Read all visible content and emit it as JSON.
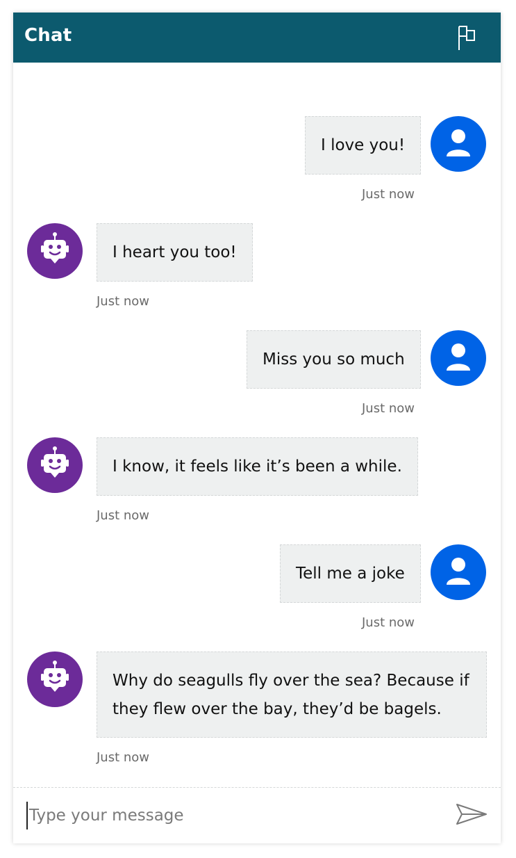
{
  "header": {
    "title": "Chat",
    "flag_icon": "flag-icon"
  },
  "colors": {
    "header_bg": "#0c5a6e",
    "user_avatar": "#0063e6",
    "bot_avatar": "#6c2b99",
    "bubble_bg": "#eef0f0"
  },
  "messages": [
    {
      "sender": "user",
      "text": "I love you!",
      "time": "Just now"
    },
    {
      "sender": "bot",
      "text": "I heart you too!",
      "time": "Just now"
    },
    {
      "sender": "user",
      "text": "Miss you so much",
      "time": "Just now"
    },
    {
      "sender": "bot",
      "text": "I know, it feels like it’s been a while.",
      "time": "Just now"
    },
    {
      "sender": "user",
      "text": "Tell me a joke",
      "time": "Just now"
    },
    {
      "sender": "bot",
      "text": "Why do seagulls fly over the sea? Because if they flew over the bay, they’d be bagels.",
      "time": "Just now"
    }
  ],
  "composer": {
    "placeholder": "Type your message",
    "value": "",
    "send_icon": "send-icon"
  }
}
